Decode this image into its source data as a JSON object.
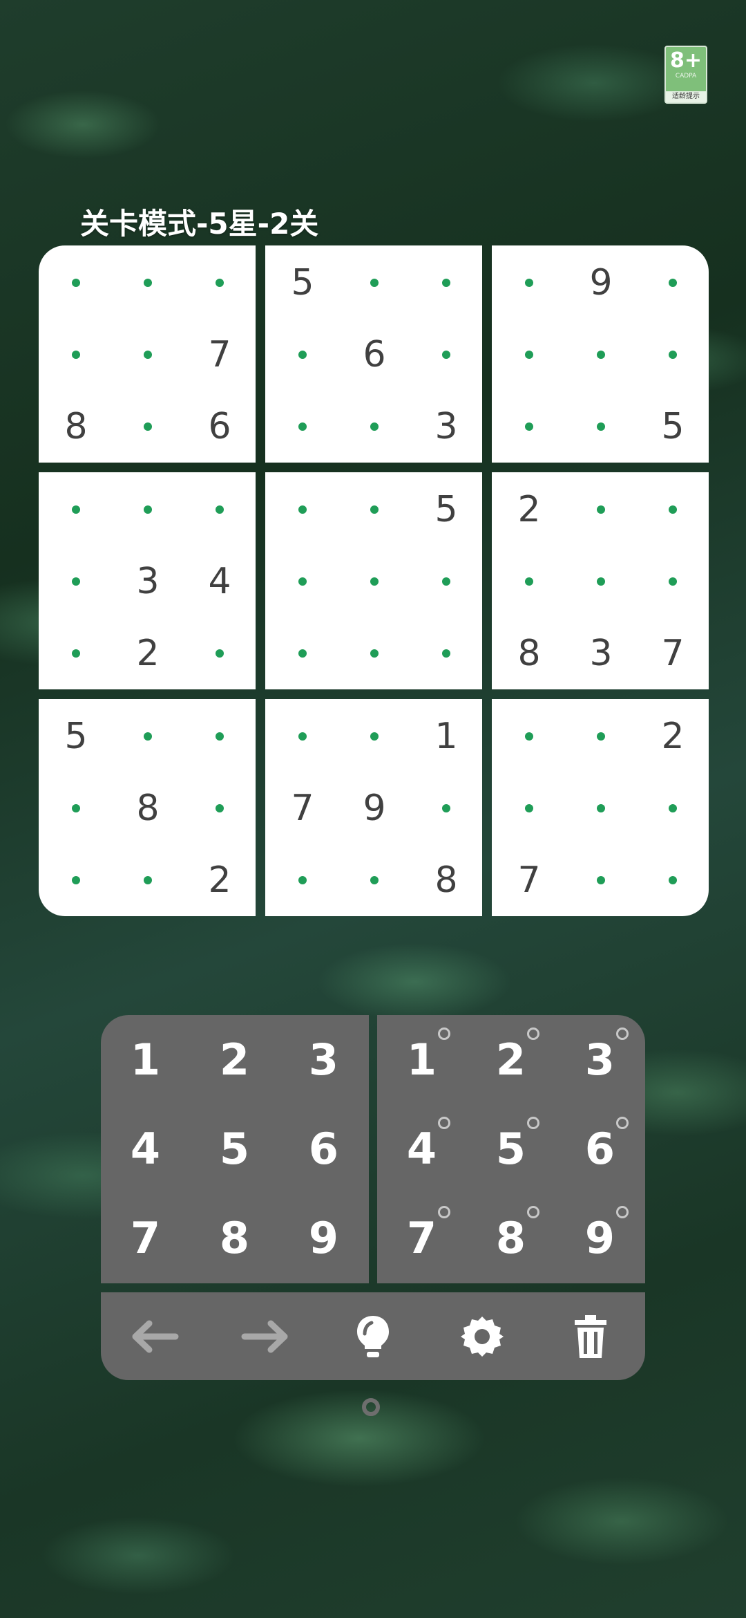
{
  "age_rating": {
    "label": "8+",
    "org": "CADPA",
    "tip": "适龄提示"
  },
  "title": "关卡模式-5星-2关",
  "puzzle": [
    [
      "",
      "",
      "",
      "5",
      "",
      "",
      "",
      "9",
      ""
    ],
    [
      "",
      "",
      "7",
      "",
      "6",
      "",
      "",
      "",
      ""
    ],
    [
      "8",
      "",
      "6",
      "",
      "",
      "3",
      "",
      "",
      "5"
    ],
    [
      "",
      "",
      "",
      "",
      "",
      "5",
      "2",
      "",
      ""
    ],
    [
      "",
      "3",
      "4",
      "",
      "",
      "",
      "",
      "",
      ""
    ],
    [
      "",
      "2",
      "",
      "",
      "",
      "",
      "8",
      "3",
      "7"
    ],
    [
      "5",
      "",
      "",
      "",
      "",
      "1",
      "",
      "",
      "2"
    ],
    [
      "",
      "8",
      "",
      "7",
      "9",
      "",
      "",
      "",
      ""
    ],
    [
      "",
      "",
      "2",
      "",
      "",
      "8",
      "7",
      "",
      ""
    ]
  ],
  "number_pad": {
    "fill": [
      "1",
      "2",
      "3",
      "4",
      "5",
      "6",
      "7",
      "8",
      "9"
    ],
    "notes": [
      "1",
      "2",
      "3",
      "4",
      "5",
      "6",
      "7",
      "8",
      "9"
    ]
  },
  "toolbar": [
    {
      "name": "undo-button",
      "icon": "arrow-left-icon"
    },
    {
      "name": "redo-button",
      "icon": "arrow-right-icon"
    },
    {
      "name": "hint-button",
      "icon": "lightbulb-icon"
    },
    {
      "name": "settings-button",
      "icon": "gear-icon"
    },
    {
      "name": "erase-button",
      "icon": "trash-icon"
    }
  ],
  "colors": {
    "empty_dot": "#1f9d57",
    "given_digit": "#404040",
    "pad_bg": "#666666",
    "icon_gray": "#a8a8a8",
    "icon_white": "#ffffff"
  }
}
